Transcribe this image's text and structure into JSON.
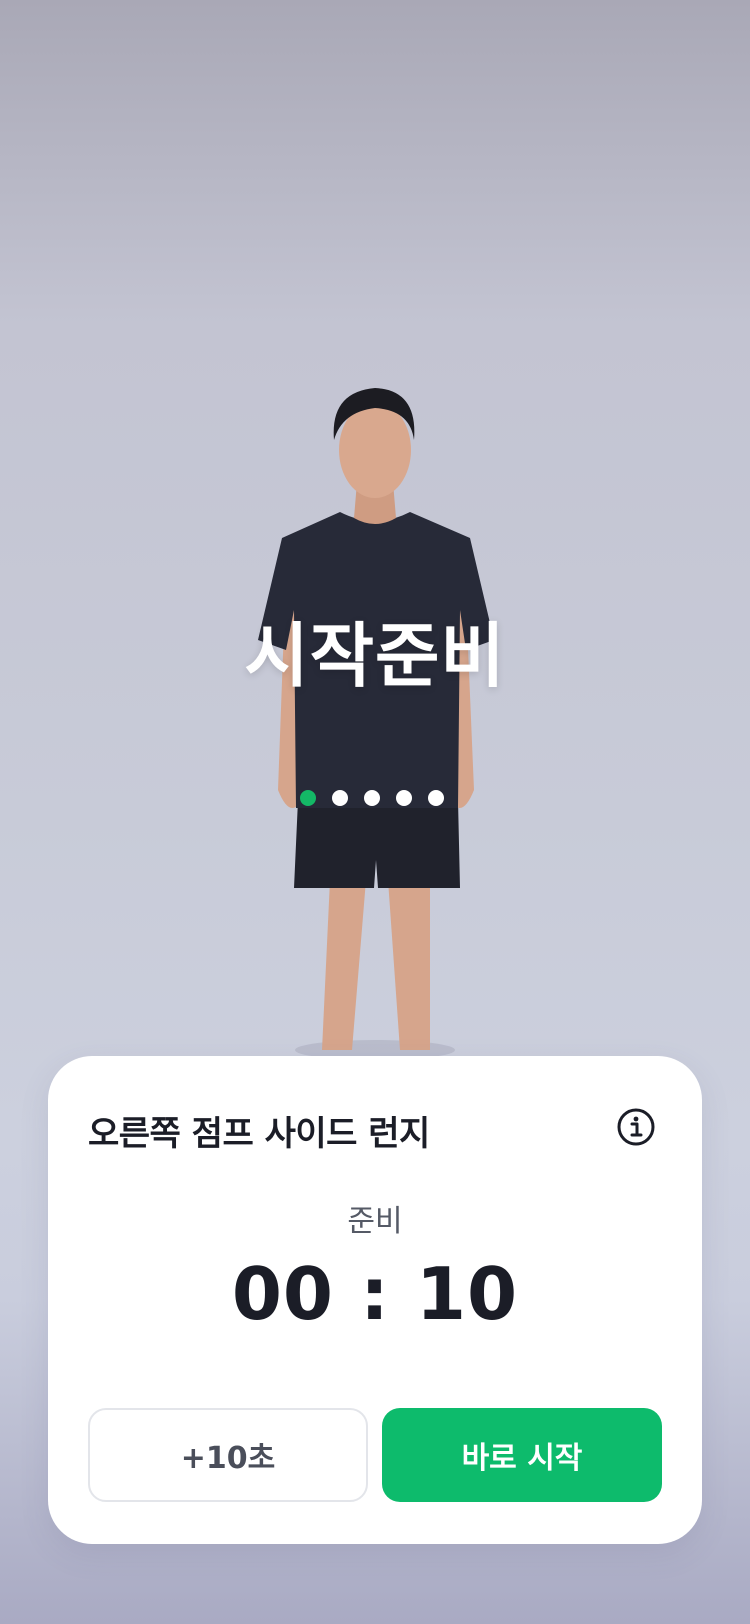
{
  "overlay": {
    "title": "시작준비",
    "page_indicator": {
      "total": 5,
      "active_index": 0
    }
  },
  "card": {
    "exercise_name": "오른쪽 점프 사이드 런지",
    "info_icon": "info-circle-icon",
    "phase_label": "준비",
    "timer": "00 : 10",
    "add_time_label": "+10초",
    "start_now_label": "바로 시작"
  },
  "colors": {
    "accent_green": "#0dbb6c",
    "active_dot": "#14b866",
    "text_dark": "#1b1d27"
  }
}
